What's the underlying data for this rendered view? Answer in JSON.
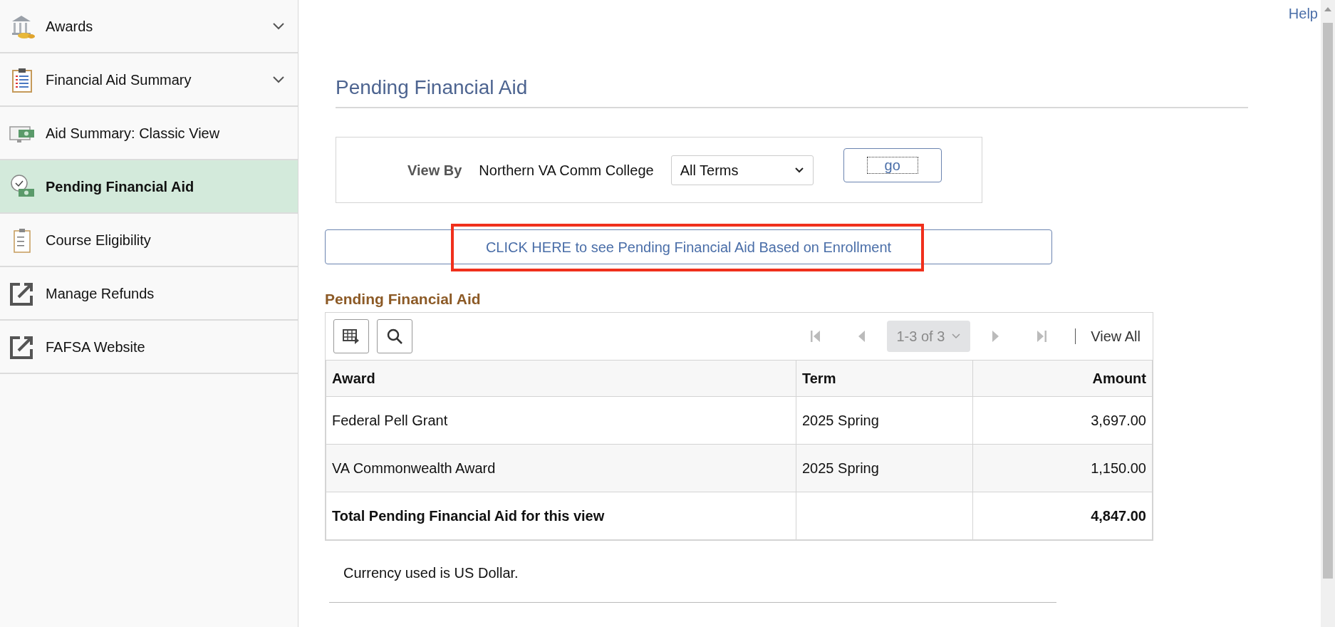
{
  "sidebar": {
    "items": [
      {
        "label": "Awards",
        "kind": "group",
        "selected": false
      },
      {
        "label": "Financial Aid Summary",
        "kind": "group",
        "selected": false
      },
      {
        "label": "Aid Summary: Classic View",
        "kind": "page",
        "selected": false
      },
      {
        "label": "Pending Financial Aid",
        "kind": "page",
        "selected": true
      },
      {
        "label": "Course Eligibility",
        "kind": "page",
        "selected": false
      },
      {
        "label": "Manage Refunds",
        "kind": "external",
        "selected": false
      },
      {
        "label": "FAFSA Website",
        "kind": "external",
        "selected": false
      }
    ]
  },
  "help_link": "Help",
  "page_title": "Pending Financial Aid",
  "view_by": {
    "label": "View By",
    "institution": "Northern VA Comm College",
    "term_select": "All Terms",
    "go_button": "go"
  },
  "enrollment_link": "CLICK HERE to see Pending Financial Aid Based on Enrollment",
  "grid": {
    "title": "Pending Financial Aid",
    "pager": {
      "range": "1-3 of 3",
      "disabled": true
    },
    "view_all": "View All",
    "columns": [
      "Award",
      "Term",
      "Amount"
    ],
    "rows": [
      {
        "cells": [
          "Federal Pell Grant",
          "2025 Spring",
          "3,697.00"
        ],
        "kind": "item"
      },
      {
        "cells": [
          "VA Commonwealth Award",
          "2025 Spring",
          "1,150.00"
        ],
        "kind": "item"
      },
      {
        "cells": [
          "Total Pending Financial Aid for this view",
          "",
          "4,847.00"
        ],
        "kind": "total"
      }
    ]
  },
  "currency_note": "Currency used is US Dollar."
}
